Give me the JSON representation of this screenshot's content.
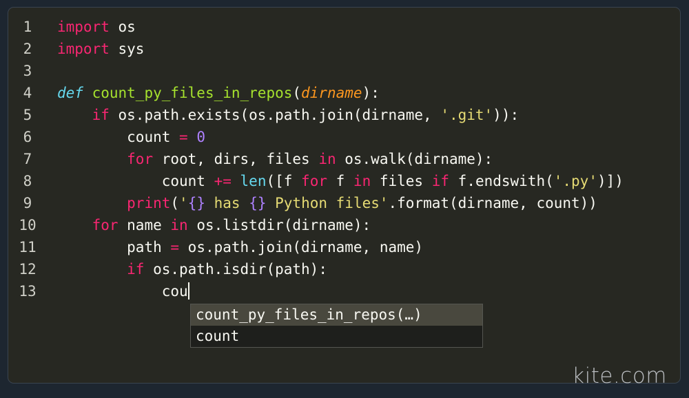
{
  "editor": {
    "lines": [
      {
        "num": "1",
        "indent": "",
        "tokens": [
          [
            "kw",
            "import"
          ],
          [
            "",
            "os"
          ]
        ]
      },
      {
        "num": "2",
        "indent": "",
        "tokens": [
          [
            "kw",
            "import"
          ],
          [
            "",
            "sys"
          ]
        ]
      },
      {
        "num": "3",
        "indent": "",
        "tokens": []
      },
      {
        "num": "4",
        "indent": "",
        "tokens": [
          [
            "def",
            "def"
          ],
          [
            "",
            " "
          ],
          [
            "fn",
            "count_py_files_in_repos"
          ],
          [
            "",
            "("
          ],
          [
            "param",
            "dirname"
          ],
          [
            "",
            "):"
          ]
        ]
      },
      {
        "num": "5",
        "indent": "    ",
        "tokens": [
          [
            "kw",
            "if"
          ],
          [
            "",
            " os.path.exists(os.path.join(dirname, "
          ],
          [
            "str",
            "'.git'"
          ],
          [
            "",
            "))"
          ],
          [
            "",
            ":"
          ]
        ]
      },
      {
        "num": "6",
        "indent": "        ",
        "tokens": [
          [
            "",
            "count "
          ],
          [
            "kw",
            "="
          ],
          [
            "",
            " "
          ],
          [
            "num",
            "0"
          ]
        ]
      },
      {
        "num": "7",
        "indent": "        ",
        "tokens": [
          [
            "kw",
            "for"
          ],
          [
            "",
            " root, dirs, files "
          ],
          [
            "kw",
            "in"
          ],
          [
            "",
            " os.walk(dirname):"
          ]
        ]
      },
      {
        "num": "8",
        "indent": "            ",
        "tokens": [
          [
            "",
            "count "
          ],
          [
            "kw",
            "+="
          ],
          [
            "",
            " "
          ],
          [
            "bi",
            "len"
          ],
          [
            "",
            "([f "
          ],
          [
            "kw",
            "for"
          ],
          [
            "",
            " f "
          ],
          [
            "kw",
            "in"
          ],
          [
            "",
            " files "
          ],
          [
            "kw",
            "if"
          ],
          [
            "",
            " f.endswith("
          ],
          [
            "str",
            "'.py'"
          ],
          [
            "",
            ")])"
          ]
        ]
      },
      {
        "num": "9",
        "indent": "        ",
        "tokens": [
          [
            "kw",
            "print"
          ],
          [
            "",
            "("
          ],
          [
            "str",
            "'"
          ],
          [
            "ph",
            "{}"
          ],
          [
            "str",
            " has "
          ],
          [
            "ph",
            "{}"
          ],
          [
            "str",
            " Python files'"
          ],
          [
            "",
            ".format(dirname, count))"
          ]
        ]
      },
      {
        "num": "10",
        "indent": "    ",
        "tokens": [
          [
            "kw",
            "for"
          ],
          [
            "",
            " name "
          ],
          [
            "kw",
            "in"
          ],
          [
            "",
            " os.listdir(dirname):"
          ]
        ]
      },
      {
        "num": "11",
        "indent": "        ",
        "tokens": [
          [
            "",
            "path "
          ],
          [
            "kw",
            "="
          ],
          [
            "",
            " os.path.join(dirname, name)"
          ]
        ]
      },
      {
        "num": "12",
        "indent": "        ",
        "tokens": [
          [
            "kw",
            "if"
          ],
          [
            "",
            " os.path.isdir(path):"
          ]
        ]
      },
      {
        "num": "13",
        "indent": "            ",
        "tokens": [
          [
            "",
            "cou"
          ]
        ],
        "cursor": true
      }
    ]
  },
  "autocomplete": {
    "items": [
      {
        "label": "count_py_files_in_repos(…)",
        "selected": true
      },
      {
        "label": "count",
        "selected": false
      }
    ]
  },
  "brand": {
    "label": "kite.com"
  }
}
